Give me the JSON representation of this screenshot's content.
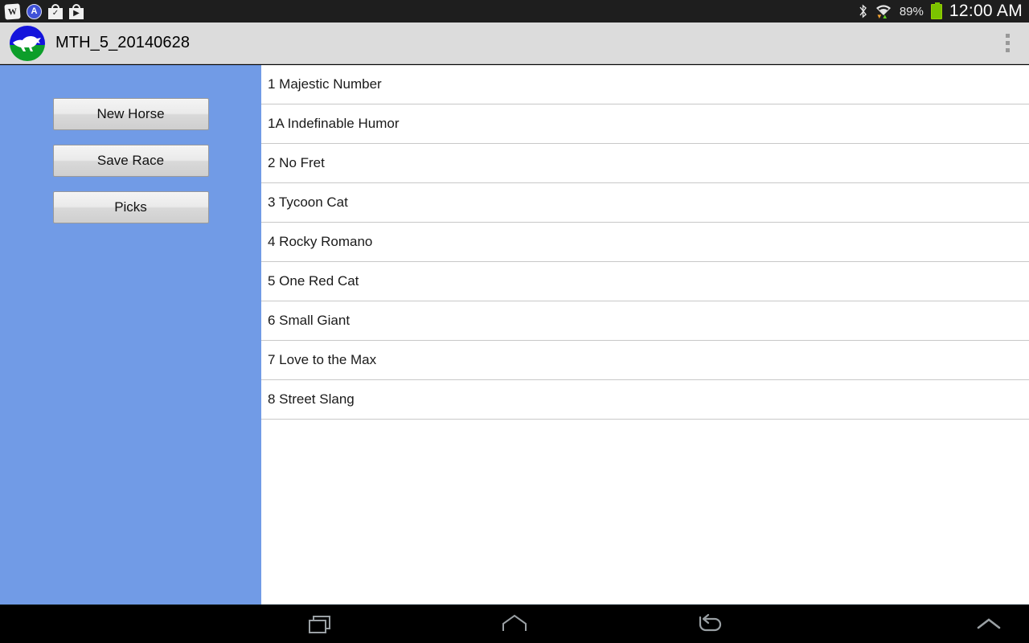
{
  "status_bar": {
    "notifications": [
      {
        "name": "wikipedia-notification-icon",
        "glyph": "W"
      },
      {
        "name": "app-notification-icon",
        "glyph": "A"
      },
      {
        "name": "play-store-installed-icon",
        "glyph": "✓"
      },
      {
        "name": "play-store-download-icon",
        "glyph": "▶"
      }
    ],
    "bluetooth": "bluetooth-icon",
    "wifi": "wifi-icon",
    "wifi_down_arrow": "▼",
    "wifi_up_arrow": "▲",
    "battery_percent": "89%",
    "battery_icon": "battery-icon",
    "clock": "12:00 AM"
  },
  "action_bar": {
    "logo": "horse-app-logo",
    "title": "MTH_5_20140628",
    "overflow": "overflow-menu"
  },
  "sidebar": {
    "background_color": "#719be6",
    "buttons": [
      {
        "label": "New Horse",
        "name": "new-horse-button"
      },
      {
        "label": "Save Race",
        "name": "save-race-button"
      },
      {
        "label": "Picks",
        "name": "picks-button"
      }
    ]
  },
  "horse_list": {
    "items": [
      "1 Majestic Number",
      "1A Indefinable Humor",
      "2 No Fret",
      "3 Tycoon Cat",
      "4 Rocky Romano",
      "5 One Red Cat",
      "6 Small Giant",
      "7 Love to the Max",
      "8 Street Slang"
    ]
  },
  "nav_bar": {
    "recents": "recents-icon",
    "home": "home-icon",
    "back": "back-icon",
    "expand": "chevron-up-icon"
  }
}
